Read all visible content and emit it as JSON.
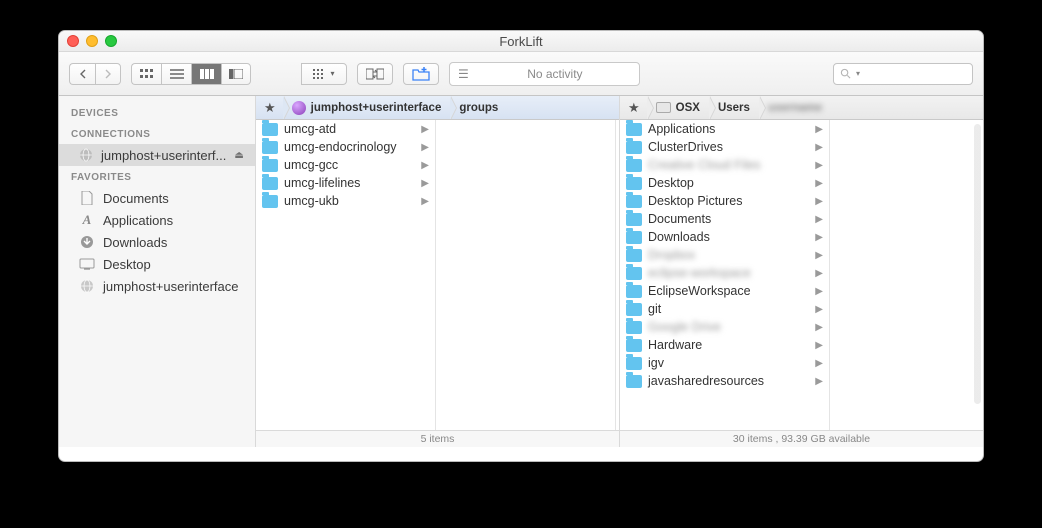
{
  "window": {
    "title": "ForkLift"
  },
  "toolbar": {
    "activity": "No activity"
  },
  "sidebar": {
    "sections": [
      {
        "title": "DEVICES",
        "items": []
      },
      {
        "title": "CONNECTIONS",
        "items": [
          {
            "label": "jumphost+userinterf...",
            "icon": "globe",
            "selected": true,
            "ejectable": true
          }
        ]
      },
      {
        "title": "FAVORITES",
        "items": [
          {
            "label": "Documents",
            "icon": "doc"
          },
          {
            "label": "Applications",
            "icon": "apps"
          },
          {
            "label": "Downloads",
            "icon": "down"
          },
          {
            "label": "Desktop",
            "icon": "desk"
          },
          {
            "label": "jumphost+userinterface",
            "icon": "globe-gray"
          }
        ]
      }
    ]
  },
  "leftPane": {
    "path": [
      {
        "kind": "star"
      },
      {
        "kind": "globe",
        "label": "jumphost+userinterface"
      },
      {
        "kind": "text",
        "label": "groups"
      }
    ],
    "items": [
      {
        "name": "umcg-atd"
      },
      {
        "name": "umcg-endocrinology"
      },
      {
        "name": "umcg-gcc"
      },
      {
        "name": "umcg-lifelines"
      },
      {
        "name": "umcg-ukb"
      }
    ],
    "status": "5 items"
  },
  "rightPane": {
    "path": [
      {
        "kind": "star"
      },
      {
        "kind": "hdd",
        "label": "OSX"
      },
      {
        "kind": "text",
        "label": "Users"
      },
      {
        "kind": "blur",
        "label": "username"
      }
    ],
    "items": [
      {
        "name": "Applications"
      },
      {
        "name": "ClusterDrives"
      },
      {
        "name": "Creative Cloud Files",
        "blurred": true
      },
      {
        "name": "Desktop"
      },
      {
        "name": "Desktop Pictures"
      },
      {
        "name": "Documents"
      },
      {
        "name": "Downloads"
      },
      {
        "name": "Dropbox",
        "blurred": true
      },
      {
        "name": "eclipse-workspace",
        "blurred": true
      },
      {
        "name": "EclipseWorkspace"
      },
      {
        "name": "git"
      },
      {
        "name": "Google Drive",
        "blurred": true
      },
      {
        "name": "Hardware"
      },
      {
        "name": "igv"
      },
      {
        "name": "javasharedresources"
      }
    ],
    "status": "30 items , 93.39 GB available"
  }
}
